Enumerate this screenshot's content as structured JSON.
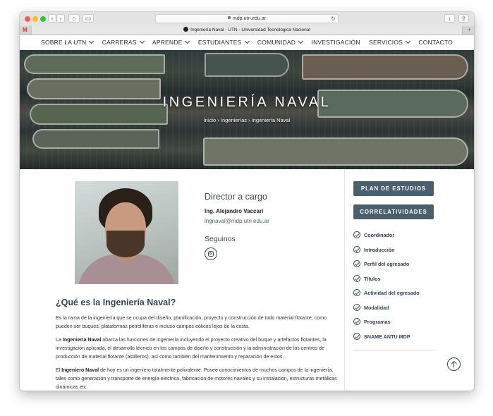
{
  "browser": {
    "url": "mdp.utn.edu.ar",
    "tab_title": "Ingeniería Naval - UTN - Universidad Tecnológica Nacional",
    "gmail_favicon": "M",
    "icons": [
      "back-icon",
      "forward-icon",
      "home-icon",
      "sidebar-icon",
      "reload-icon",
      "download-icon",
      "share-icon",
      "plus-icon"
    ]
  },
  "nav": {
    "items": [
      "SOBRE LA UTN",
      "CARRERAS",
      "APRENDE",
      "ESTUDIANTES",
      "COMUNIDAD",
      "INVESTIGACIÓN",
      "SERVICIOS",
      "CONTACTO"
    ]
  },
  "hero": {
    "title": "INGENIERÍA NAVAL",
    "breadcrumb": "Inicio › Ingenierías › Ingeniería Naval"
  },
  "director": {
    "heading": "Director a cargo",
    "name": "Ing. Alejandro Vaccari",
    "email": "ingnaval@mdp.utn.edu.ar",
    "follow_heading": "Seguinos",
    "social_icon": "instagram-icon"
  },
  "about": {
    "heading": "¿Qué es la Ingeniería Naval?",
    "p1": "Es la rama de la ingeniería que se ocupa del diseño, planificación, proyecto y construcción de todo material flotante, como pueden ser buques, plataformas petrolíferas e incluso campos eólicos lejos de la costa.",
    "p2_pre": "La ",
    "p2_bold": "Ingeniería Naval",
    "p2_post": " abarca las funciones de ingeniería incluyendo el proyecto creativo del buque y artefactos flotantes, la investigación aplicada, el desarrollo técnico en los campos de diseño y construcción y la administración de los centros de producción de material flotante (astilleros), así como también del mantenimiento y reparación de estos.",
    "p3_pre": "El ",
    "p3_bold": "Ingeniero Naval",
    "p3_post": " de hoy es un ingeniero totalmente polivalente. Posee conocimientos de muchos campos de la ingeniería, tales como generación y transporte de energía eléctrica, fabricación de motores navales y su instalación, estructuras metálicas dinámicas etc."
  },
  "sidebar": {
    "buttons": [
      "PLAN DE ESTUDIOS",
      "CORRELATIVIDADES"
    ],
    "items": [
      "Coordinador",
      "Introducción",
      "Perfil del egresado",
      "Títulos",
      "Actividad del egresado",
      "Modalidad",
      "Programas",
      "SNAME ANTU MDP"
    ],
    "item_icon": "check-circle-icon",
    "scroll_top_icon": "arrow-up-circle-icon"
  },
  "colors": {
    "accent": "#4b606f",
    "heading": "#33475a",
    "link": "#4a6274"
  }
}
